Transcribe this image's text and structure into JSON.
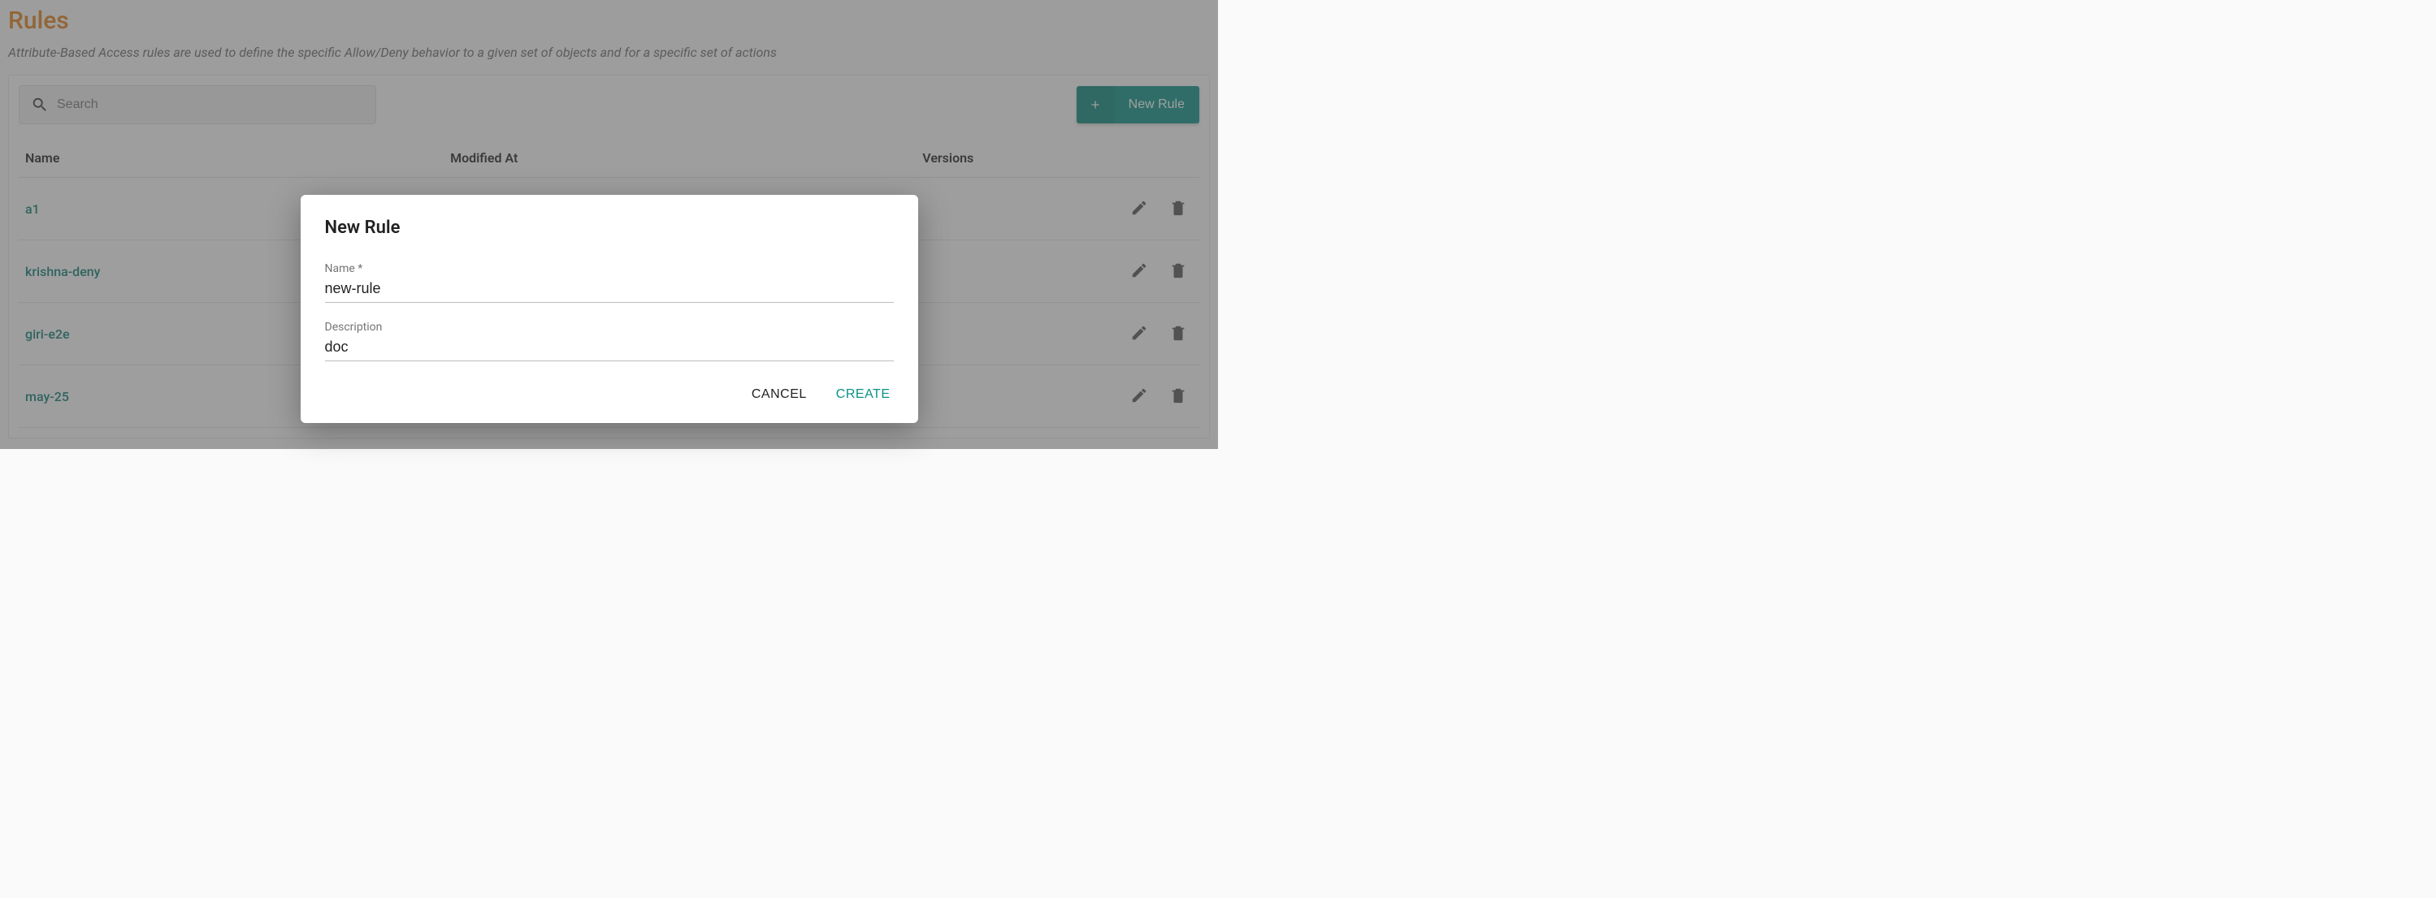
{
  "header": {
    "title": "Rules",
    "subtitle": "Attribute-Based Access rules are used to define the specific Allow/Deny behavior to a given set of objects and for a specific set of actions"
  },
  "toolbar": {
    "search_placeholder": "Search",
    "search_value": "",
    "new_rule_label": "New Rule"
  },
  "table": {
    "columns": {
      "name": "Name",
      "modified_at": "Modified At",
      "versions": "Versions"
    },
    "rows": [
      {
        "name": "a1"
      },
      {
        "name": "krishna-deny"
      },
      {
        "name": "giri-e2e"
      },
      {
        "name": "may-25"
      }
    ]
  },
  "dialog": {
    "title": "New Rule",
    "name_label": "Name *",
    "name_value": "new-rule",
    "description_label": "Description",
    "description_value": "doc",
    "cancel_label": "CANCEL",
    "create_label": "CREATE"
  }
}
